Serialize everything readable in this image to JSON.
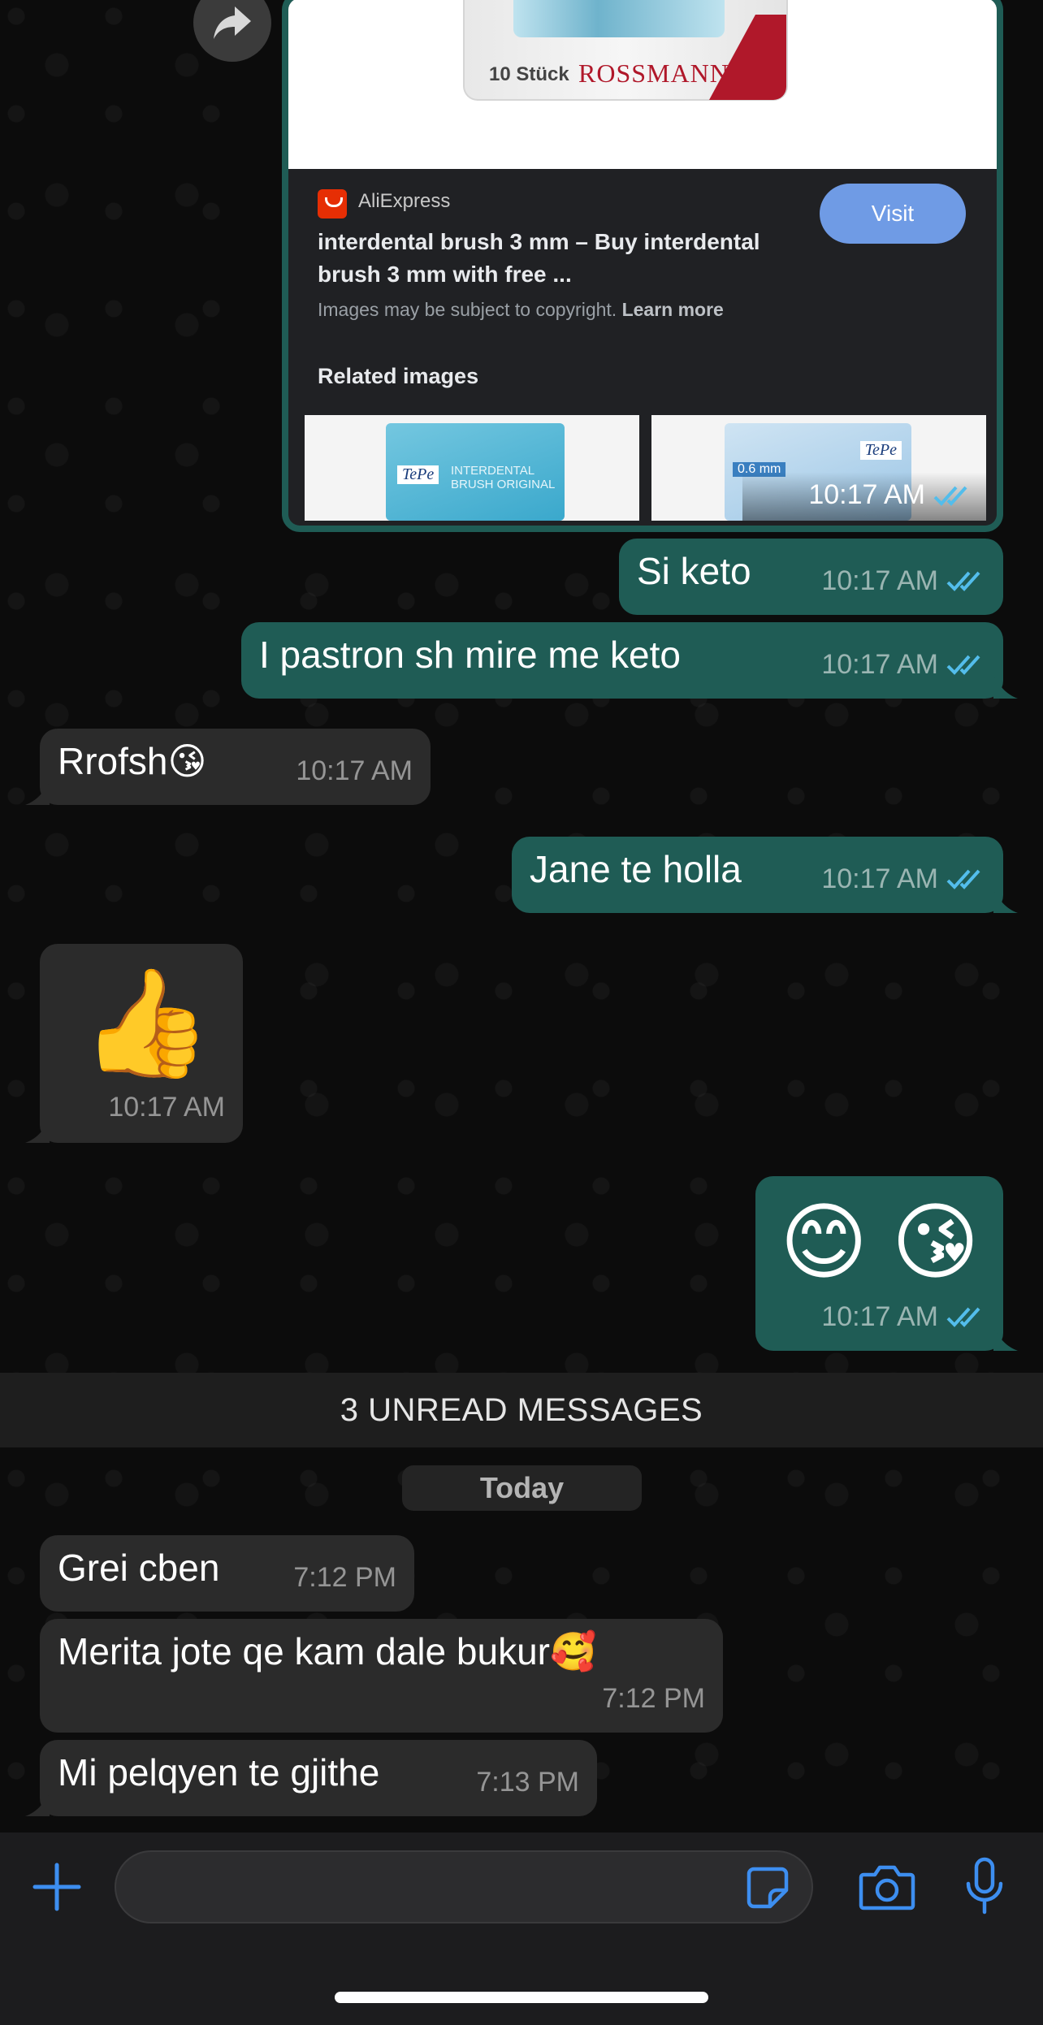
{
  "colors": {
    "outgoing_bubble": "#1f5c55",
    "incoming_bubble": "#2b2b2b",
    "read_ticks": "#53bdeb",
    "accent_icons": "#3d8ef0",
    "visit_button": "#6f9be5"
  },
  "link_preview": {
    "package_count": "10 Stück",
    "package_brand": "ROSSMANN",
    "source": "AliExpress",
    "title": "interdental brush 3 mm – Buy interdental brush 3 mm with free ...",
    "visit_label": "Visit",
    "copyright_text": "Images may be subject to copyright.",
    "learn_more": "Learn more",
    "related_heading": "Related images",
    "thumb1_brand": "TePe",
    "thumb1_text": "INTERDENTAL BRUSH ORIGINAL",
    "thumb2_brand": "TePe",
    "thumb2_text": "0.6 mm",
    "time": "10:17 AM"
  },
  "messages": [
    {
      "direction": "out",
      "text": "Si keto",
      "time": "10:17 AM"
    },
    {
      "direction": "out",
      "text": "I pastron sh mire me keto",
      "time": "10:17 AM"
    },
    {
      "direction": "in",
      "text": "Rrofsh😘",
      "time": "10:17 AM"
    },
    {
      "direction": "out",
      "text": "Jane te holla",
      "time": "10:17 AM"
    },
    {
      "direction": "in",
      "text": "👍",
      "time": "10:17 AM"
    },
    {
      "direction": "out",
      "text": "😊 😘",
      "time": "10:17 AM"
    },
    {
      "direction": "in",
      "text": "Grei cben",
      "time": "7:12 PM"
    },
    {
      "direction": "in",
      "text": "Merita jote qe kam dale bukur🥰",
      "time": "7:12 PM"
    },
    {
      "direction": "in",
      "text": "Mi pelqyen te gjithe",
      "time": "7:13 PM"
    }
  ],
  "unread_banner": "3 UNREAD MESSAGES",
  "date_chip": "Today",
  "composer": {
    "placeholder": "",
    "icons": [
      "plus-icon",
      "sticker-icon",
      "camera-icon",
      "microphone-icon"
    ]
  }
}
